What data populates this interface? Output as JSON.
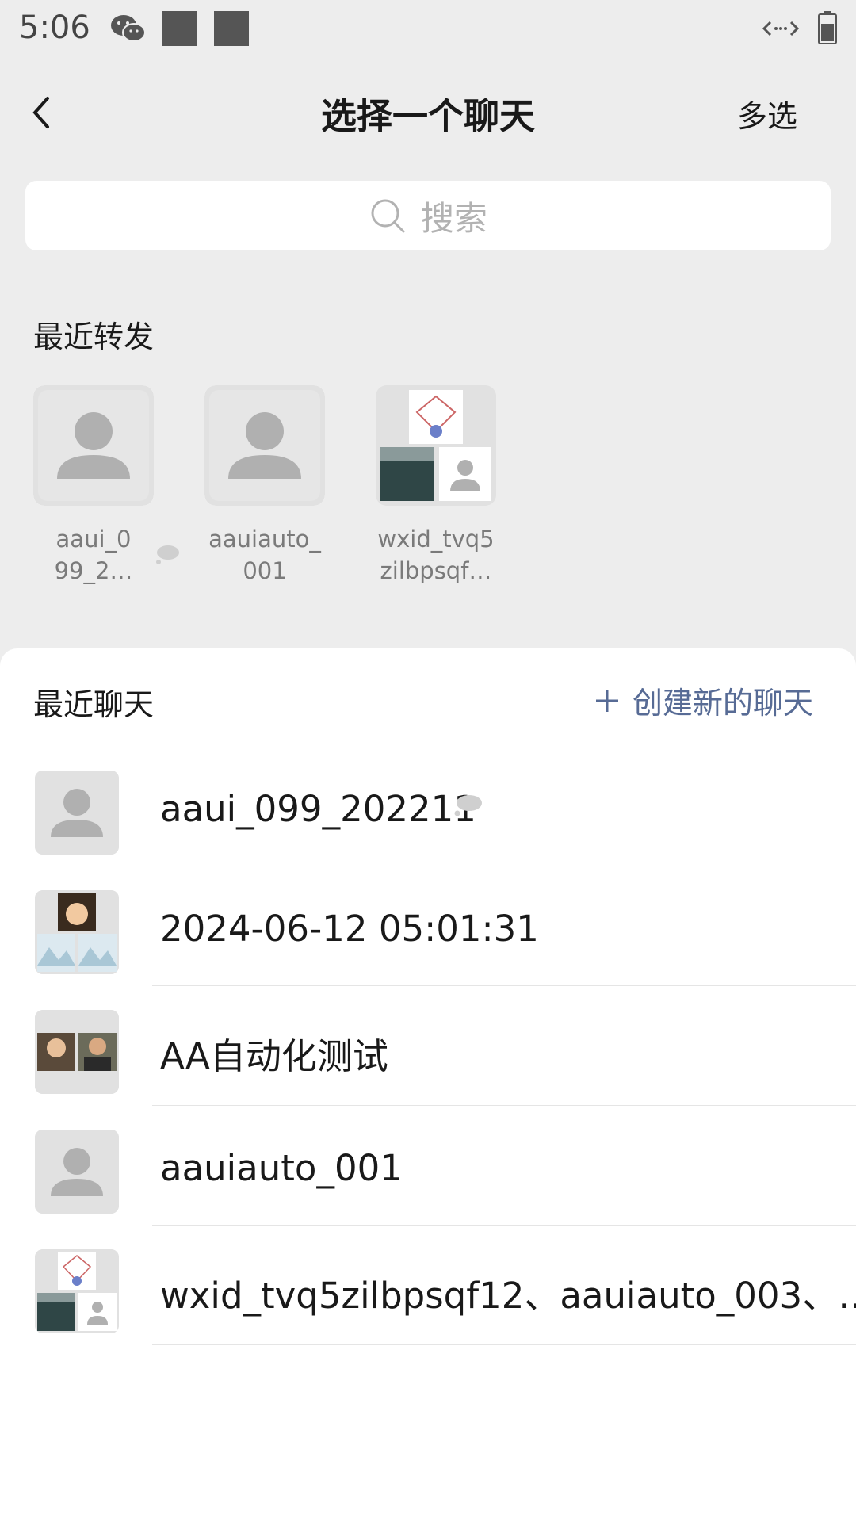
{
  "status_bar": {
    "time": "5:06"
  },
  "nav": {
    "back_icon": "chevron-left-icon",
    "title": "选择一个聊天",
    "multi_select": "多选"
  },
  "search": {
    "placeholder": "搜索",
    "icon": "search-icon"
  },
  "recent_forward": {
    "title": "最近转发",
    "items": [
      {
        "name_line1": "aaui_0",
        "name_line2": "99_2…",
        "muted": true
      },
      {
        "name_line1": "aauiauto_",
        "name_line2": "001",
        "muted": false
      },
      {
        "name_line1": "wxid_tvq5",
        "name_line2": "zilbpsqf…",
        "muted": false
      }
    ]
  },
  "recent_chats": {
    "title": "最近聊天",
    "create_new": "创建新的聊天",
    "items": [
      {
        "name": "aaui_099_202211",
        "muted": true
      },
      {
        "name": "2024-06-12 05:01:31",
        "muted": false
      },
      {
        "name": "AA自动化测试",
        "muted": false
      },
      {
        "name": "aauiauto_001",
        "muted": false
      },
      {
        "name": "wxid_tvq5zilbpsqf12、aauiauto_003、…",
        "muted": false
      }
    ]
  },
  "colors": {
    "link": "#576b95",
    "background": "#ededed",
    "default_avatar": "#e1e1e1"
  }
}
